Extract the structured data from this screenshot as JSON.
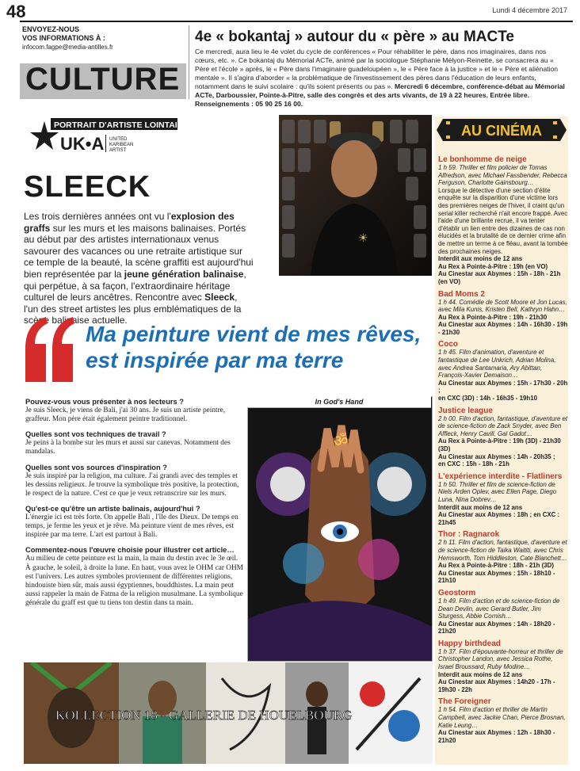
{
  "header": {
    "page_number": "48",
    "date": "Lundi 4 décembre 2017",
    "contact_title_1": "ENVOYEZ-NOUS",
    "contact_title_2": "VOS INFORMATIONS À :",
    "contact_email": "infocom.fagpe@media-antilles.fr",
    "section": "CULTURE"
  },
  "event": {
    "title": "4e « bokantaj » autour du « père » au MACTe",
    "body": "Ce mercredi, aura lieu le 4e volet du cycle de conférences « Pour réhabiliter le père, dans nos imaginaires, dans nos cœurs, etc. ». Ce bokantaj du Mémorial ACTe, animé par la sociologue Stéphanie Mélyon-Reinette, se consacrera au « Père et l'école » après, le « Père dans l'imaginaire guadeloupéen », le « Père face à la justice » et le « Père et aliénation mentale ». Il s'agira d'aborder « la problématique de l'investissement des pères dans l'éducation de leurs enfants, notamment dans le suivi scolaire : qu'ils soient présents ou pas ».",
    "body_bold": "Mercredi 6 décembre, conférence-débat au Mémorial ACTe, Darboussier, Pointe-à-Pitre, salle des congrès et des arts vivants, de 19 à 22 heures. Entrée libre. Renseignements : 05 90 25 16 00."
  },
  "article": {
    "kicker": "PORTRAIT D'ARTISTE LOINTAIN",
    "logo_letters": "UK•A",
    "logo_sub_1": "UNITED",
    "logo_sub_2": "KARIBEAN",
    "logo_sub_3": "ARTIST",
    "name": "SLEECK",
    "intro_1": "Les trois dernières années ont vu l'",
    "intro_b1": "explosion des graffs",
    "intro_2": " sur les murs et les maisons balinaises. Portés au début par des artistes internationaux venus savourer des vacances ou une retraite artistique sur ce temple de la beauté, la scène graffiti est aujourd'hui bien représentée par la ",
    "intro_b2": "jeune génération balinaise",
    "intro_3": ", qui perpétue, à sa façon, l'extraordinaire héritage culturel de leurs ancêtres. Rencontre avec ",
    "intro_b3": "Sleeck",
    "intro_4": ", l'un des street artistes les plus emblématiques de la scène balinaise actuelle.",
    "quote": "Ma peinture vient de mes rêves, est inspirée par ma terre",
    "painting_caption": "In God's Hand",
    "gallery_text": "KOLLECTION 18 - GALLERIE DE HOUELBOURG",
    "qa": [
      {
        "q": "Pouvez-vous vous présenter à nos lecteurs ?",
        "a": "Je suis Sleeck, je viens de Bali, j'ai 30 ans. Je suis un artiste peintre, graffeur. Mon père était également peintre traditionnel."
      },
      {
        "q": "Quelles sont vos techniques de travail ?",
        "a": "Je peins à la bombe sur les murs et aussi sur canevas. Notamment des mandalas."
      },
      {
        "q": "Quelles sont vos sources d'inspiration ?",
        "a": "Je suis inspiré par la religion, ma culture. J'ai grandi avec des temples et les dessins religieux. Je trouve la symbolique très positive, la protection, le respect de la nature. C'est ce que je veux retranscrire sur les murs."
      },
      {
        "q": "Qu'est-ce qu'être un artiste balinais, aujourd'hui ?",
        "a": "L'énergie ici est très forte. On appelle Bali , l'île des Dieux. De temps en temps, je ferme les yeux et je rêve. Ma peinture vient de mes rêves, est inspirée par ma terre. L'art est partout à Bali."
      },
      {
        "q": "Commentez-nous l'œuvre choisie pour illustrer cet article…",
        "a": "Au milieu de cette peinture est la main, la main du destin avec le 3e œil. À gauche, le soleil, à droite la lune. En haut, vous avez le OHM car OHM est l'univers. Les autres symboles proviennent de différentes religions, hindouiste bien sûr, mais aussi égyptiennes, bouddhistes. La main peut aussi rappeler la main de Fatma de la religion musulmane. La symbolique générale du graff est que tu tiens ton destin dans ta main."
      }
    ]
  },
  "cinema": {
    "banner": "AU CINÉMA",
    "movies": [
      {
        "title": "Le bonhomme de neige",
        "desc": "1 h 59. Thriller et film policier de Tomas Alfredson, avec Michael Fassbender, Rebecca Ferguson, Charlotte Gainsbourg…",
        "extra": "Lorsque le détective d'une section d'élite enquête sur la disparition d'une victime lors des premières neiges de l'hiver, il craint qu'un serial killer recherché n'ait encore frappé. Avec l'aide d'une brillante recrue, il va tenter d'établir un lien entre des dizaines de cas non élucidés et la brutalité de ce dernier crime afin de mettre un terme à ce fléau, avant la tombée des prochaines neiges.",
        "lines": [
          "Interdit aux moins de 12 ans",
          "Au Rex à Pointe-à-Pitre : 19h (en VO)",
          "Au Cinestar aux Abymes : 15h - 18h - 21h (en VO)"
        ]
      },
      {
        "title": "Bad Moms 2",
        "desc": "1 h 44. Comédie de Scott Moore et Jon Lucas, avec Mila Kunis, Kristen Bell, Kathryn Hahn…",
        "extra": "",
        "lines": [
          "Au Rex à Pointe-à-Pitre : 19h - 21h30",
          "Au Cinestar aux Abymes : 14h - 16h30 - 19h - 21h30"
        ]
      },
      {
        "title": "Coco",
        "desc": "1 h 45. Film d'animation, d'aventure et fantastique de Lee Unkrich, Adrian Molina, avec Andrea Santamaria, Ary Abittan, François-Xavier Demaison…",
        "extra": "",
        "lines": [
          "Au Cinestar aux Abymes : 15h - 17h30 - 20h ;",
          "en CXC (3D) : 14h - 16h35 - 19h10"
        ]
      },
      {
        "title": "Justice league",
        "desc": "2 h 00. Film d'action, fantastique, d'aventure et de science-fiction de Zack Snyder, avec Ben Affleck, Henry Cavill, Gal Gadot…",
        "extra": "",
        "lines": [
          "Au Rex à Pointe-à-Pitre : 19h (3D) - 21h30 (3D)",
          "Au Cinestar aux Abymes : 14h - 20h35 ;",
          "en CXC : 15h - 18h - 21h"
        ]
      },
      {
        "title": "L'expérience interdite - Flatliners",
        "desc": "1 h 50. Thriller et film de science-fiction de Niels Arden Oplev, avec Ellen Page, Diego Luna, Nina Dobrev…",
        "extra": "",
        "lines": [
          "Interdit aux moins de 12 ans",
          "Au Cinestar aux Abymes : 18h ; en CXC : 21h45"
        ]
      },
      {
        "title": "Thor : Ragnarok",
        "desc": "2 h 11. Film d'action, fantastique, d'aventure et de science-fiction de Taika Waititi, avec Chris Hemsworth, Tom Hiddleston, Cate Blanchett…",
        "extra": "",
        "lines": [
          "Au Rex à Pointe-à-Pitre : 18h - 21h (3D)",
          "Au Cinestar aux Abymes : 15h - 18h10 - 21h10"
        ]
      },
      {
        "title": "Geostorm",
        "desc": "1 h 49. Film d'action et de science-fiction de Dean Devlin, avec Gerard Butler, Jim Sturgess, Abbie Cornish…",
        "extra": "",
        "lines": [
          "Au Cinestar aux Abymes : 14h - 18h20 - 21h20"
        ]
      },
      {
        "title": "Happy birthdead",
        "desc": "1 h 37. Film d'épouvante-horreur et thriller de Christopher Landon, avec Jessica Rothe, Israel Broussard, Ruby Modine…",
        "extra": "",
        "lines": [
          "Interdit aux moins de 12 ans",
          "Au Cinestar aux Abymes : 14h20 - 17h - 19h30 - 22h"
        ]
      },
      {
        "title": "The Foreigner",
        "desc": "1 h 54. Film d'action et thriller de Martin Campbell, avec Jackie Chan, Pierce Brosnan, Katie Leung…",
        "extra": "",
        "lines": [
          "Au Cinestar aux Abymes : 12h - 18h30 - 21h20"
        ]
      }
    ]
  }
}
